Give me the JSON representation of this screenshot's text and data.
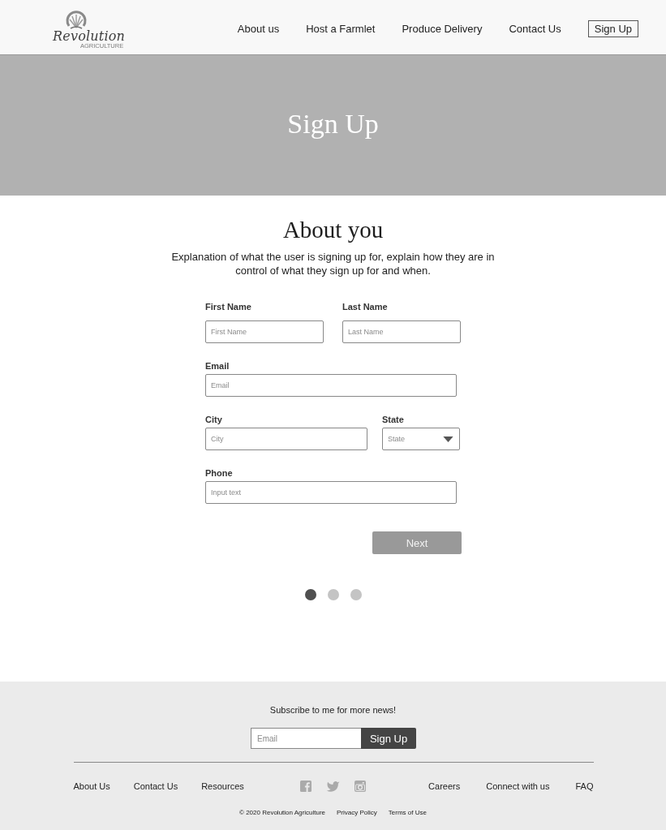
{
  "header": {
    "logo": {
      "wordmark": "Revolution",
      "tagline": "AGRICULTURE"
    },
    "nav": [
      {
        "label": "About us",
        "kind": "link"
      },
      {
        "label": "Host a Farmlet",
        "kind": "link"
      },
      {
        "label": "Produce Delivery",
        "kind": "link"
      },
      {
        "label": "Contact Us",
        "kind": "link"
      },
      {
        "label": "Sign Up",
        "kind": "button"
      }
    ]
  },
  "hero": {
    "title": "Sign Up"
  },
  "section": {
    "heading": "About you",
    "description": "Explanation of what the user is signing up for, explain how they are in control of what they sign up for and when."
  },
  "form": {
    "rows": [
      [
        {
          "label": "First Name",
          "placeholder": "First Name",
          "kind": "text"
        },
        {
          "label": "Last Name",
          "placeholder": "Last Name",
          "kind": "text"
        }
      ],
      [
        {
          "label": "Email",
          "placeholder": "Email",
          "kind": "text"
        }
      ],
      [
        {
          "label": "City",
          "placeholder": "City",
          "kind": "text"
        },
        {
          "label": "State",
          "placeholder": "State",
          "kind": "select"
        }
      ],
      [
        {
          "label": "Phone",
          "placeholder": "Input text",
          "kind": "text"
        }
      ]
    ],
    "next_button": "Next"
  },
  "steps": [
    {
      "selected": true
    },
    {
      "selected": false
    },
    {
      "selected": false
    }
  ],
  "footer": {
    "subscribe": {
      "text": "Subscribe to me for more news!",
      "placeholder": "Email",
      "button": "Sign Up"
    },
    "links_left": [
      "About Us",
      "Contact Us",
      "Resources"
    ],
    "links_right": [
      "Careers",
      "Connect with us",
      "FAQ"
    ],
    "legal": [
      "© 2020 Revolution Agriculture",
      "Privacy Policy",
      "Terms of Use"
    ]
  }
}
